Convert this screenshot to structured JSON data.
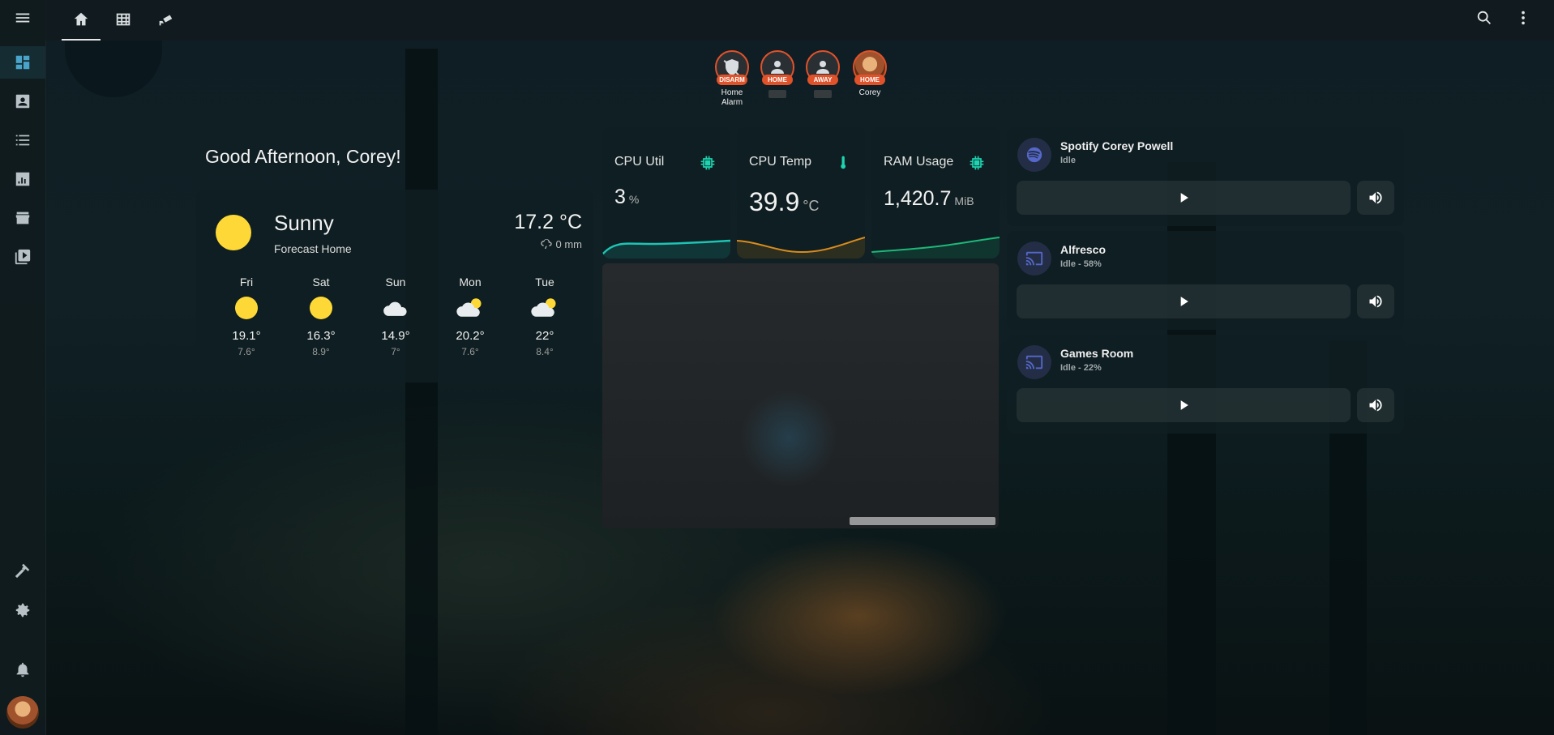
{
  "people": [
    {
      "badge": "DISARM",
      "name": "Home Alarm",
      "icon": "shield-off-icon"
    },
    {
      "badge": "HOME",
      "name": "",
      "icon": "person-icon"
    },
    {
      "badge": "AWAY",
      "name": "",
      "icon": "person-icon"
    },
    {
      "badge": "HOME",
      "name": "Corey",
      "icon": "avatar-photo"
    }
  ],
  "greeting": "Good Afternoon, Corey!",
  "weather": {
    "condition": "Sunny",
    "subtitle": "Forecast Home",
    "temperature": "17.2 °C",
    "precipitation": "0 mm",
    "forecast": [
      {
        "day": "Fri",
        "icon": "sunny",
        "high": "19.1°",
        "low": "7.6°"
      },
      {
        "day": "Sat",
        "icon": "sunny",
        "high": "16.3°",
        "low": "8.9°"
      },
      {
        "day": "Sun",
        "icon": "cloudy",
        "high": "14.9°",
        "low": "7°"
      },
      {
        "day": "Mon",
        "icon": "partly-cloudy",
        "high": "20.2°",
        "low": "7.6°"
      },
      {
        "day": "Tue",
        "icon": "partly-cloudy",
        "high": "22°",
        "low": "8.4°"
      }
    ]
  },
  "sensors": {
    "cpu_util": {
      "label": "CPU Util",
      "value": "3",
      "unit": "%",
      "color": "#1dc4b4"
    },
    "cpu_temp": {
      "label": "CPU Temp",
      "value": "39.9",
      "unit": "°C",
      "color": "#d98c1e"
    },
    "ram": {
      "label": "RAM Usage",
      "value": "1,420.7",
      "unit": "MiB",
      "color": "#1db87a"
    }
  },
  "media": [
    {
      "title": "Spotify Corey Powell",
      "state": "Idle",
      "icon": "spotify-icon"
    },
    {
      "title": "Alfresco",
      "state": "Idle - 58%",
      "icon": "cast-icon"
    },
    {
      "title": "Games Room",
      "state": "Idle - 22%",
      "icon": "cast-icon"
    }
  ],
  "colors": {
    "accent": "#4aa3c8",
    "alert_badge": "#e0522a",
    "sun": "#fdd836"
  }
}
